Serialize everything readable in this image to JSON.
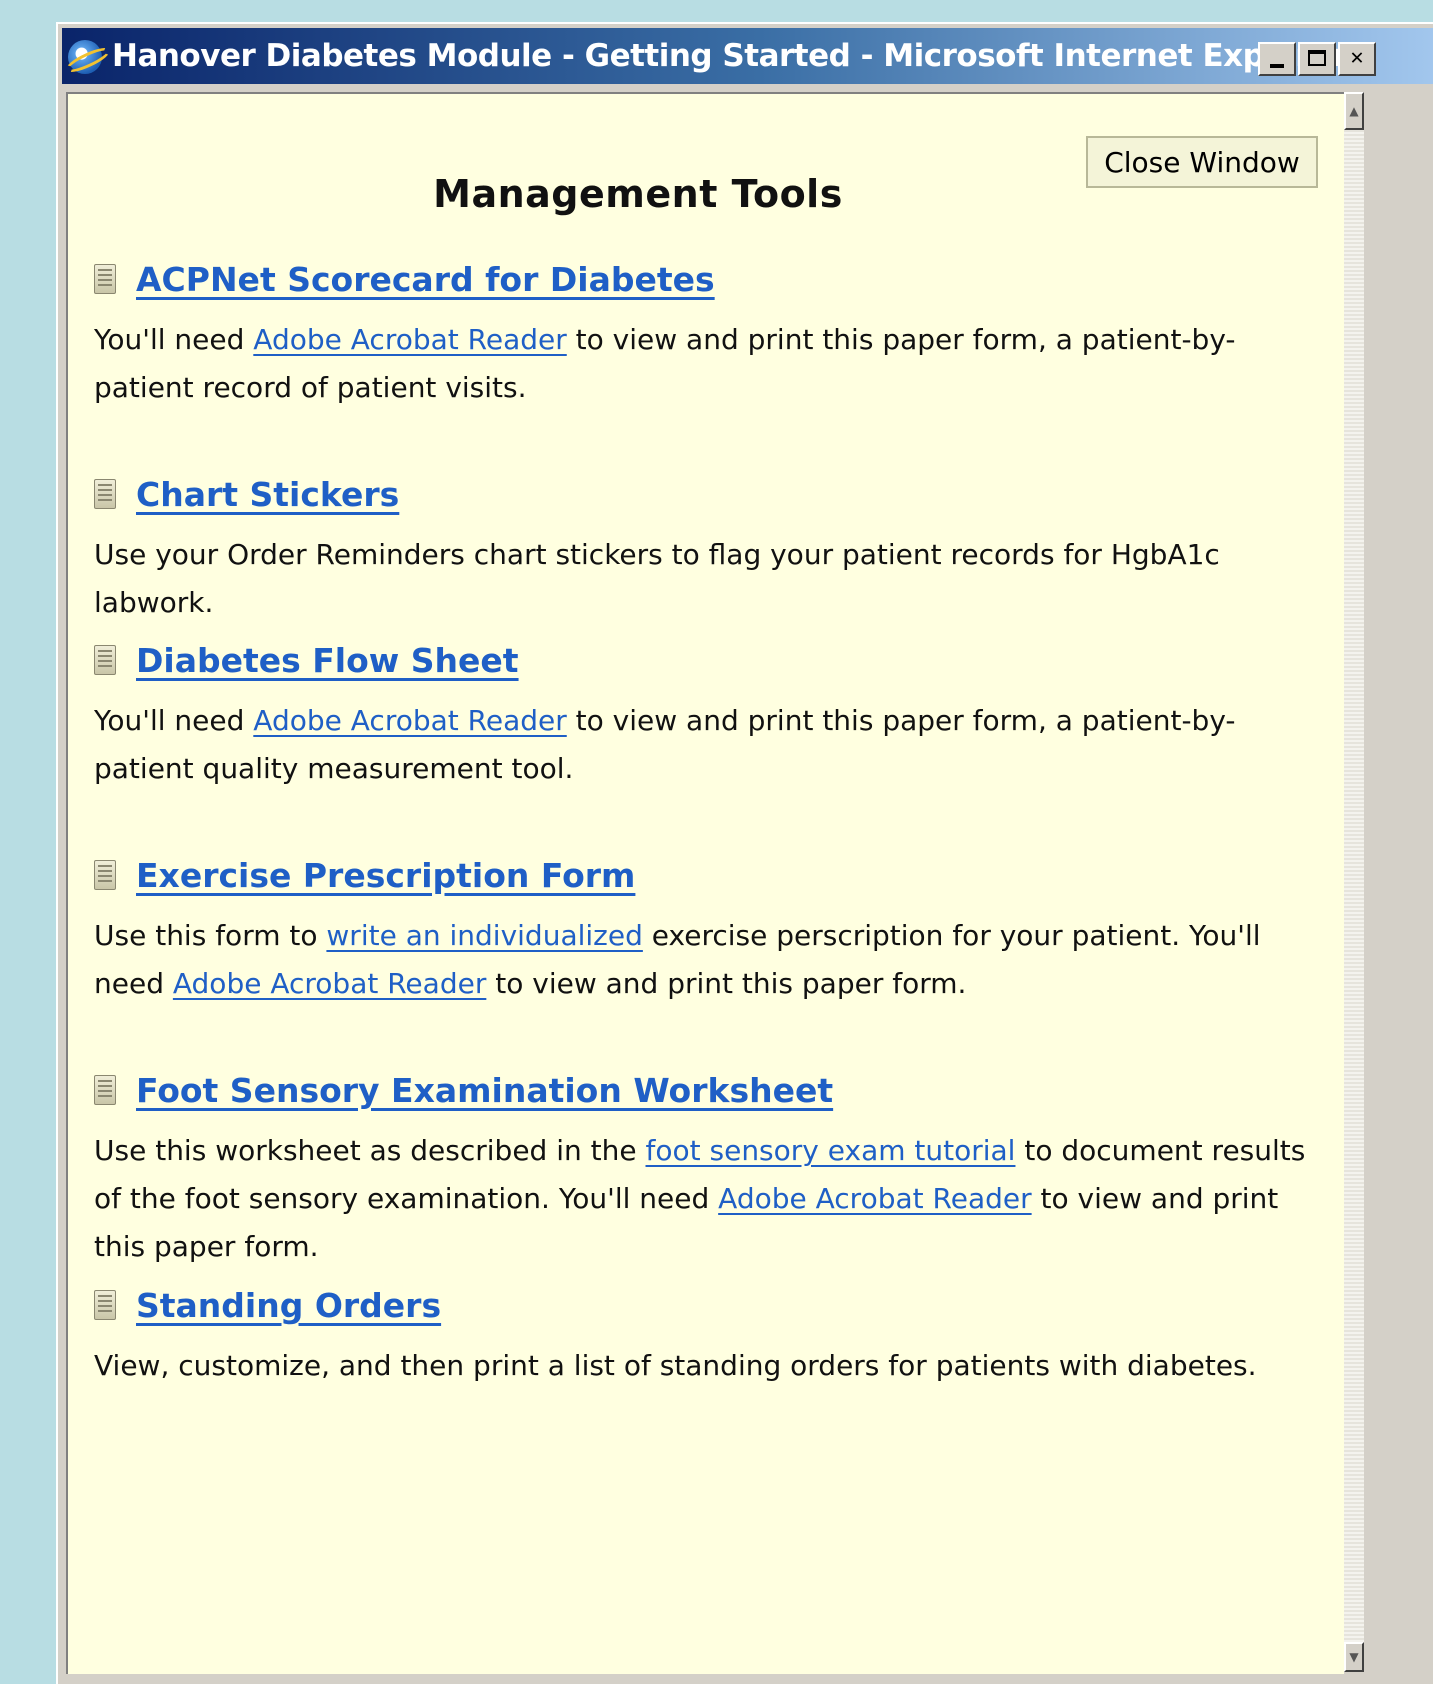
{
  "window": {
    "title": "Hanover Diabetes Module - Getting Started - Microsoft Internet Explorer",
    "app_icon": "internet-explorer-icon",
    "buttons": {
      "minimize": "minimize-icon",
      "maximize": "maximize-icon",
      "close": "close-icon"
    }
  },
  "page": {
    "title": "Management Tools",
    "close_button": "Close Window",
    "link_color": "#1f5fc6",
    "background_color": "#ffffe0"
  },
  "sections": [
    {
      "title": "ACPNet Scorecard for Diabetes",
      "icon": "document-icon",
      "desc": {
        "pre": "You'll need ",
        "link1": "Adobe Acrobat Reader",
        "post": " to view and print this paper form, a patient-by-patient record of patient visits."
      }
    },
    {
      "title": "Chart Stickers",
      "icon": "document-icon",
      "desc": {
        "text": "Use your Order Reminders chart stickers to flag your patient records for HgbA1c labwork."
      }
    },
    {
      "title": "Diabetes Flow Sheet",
      "icon": "document-icon",
      "desc": {
        "pre": "You'll need ",
        "link1": "Adobe Acrobat Reader",
        "post": " to view and print this paper form, a patient-by-patient quality measurement tool."
      }
    },
    {
      "title": "Exercise Prescription Form",
      "icon": "document-icon",
      "desc": {
        "pre": "Use this form to ",
        "link1": "write an individualized",
        "mid": " exercise perscription for your patient. You'll need ",
        "link2": "Adobe Acrobat Reader",
        "post": " to view and print this paper form."
      }
    },
    {
      "title": "Foot Sensory Examination Worksheet",
      "icon": "document-icon",
      "desc": {
        "pre": "Use this worksheet as described in the ",
        "link1": "foot sensory exam tutorial",
        "mid": " to document results of the foot sensory examination. You'll need ",
        "link2": "Adobe Acrobat Reader",
        "post": " to view and print this paper form."
      }
    },
    {
      "title": "Standing Orders",
      "icon": "document-icon",
      "desc": {
        "text": "View, customize, and then print a list of standing orders for patients with diabetes."
      }
    }
  ]
}
